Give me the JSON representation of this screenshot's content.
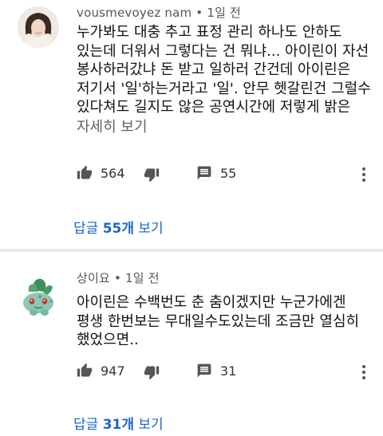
{
  "comments": [
    {
      "author": "vousmevoyez nam",
      "separator": "•",
      "time": "1일 전",
      "text_lines": [
        "누가봐도 대충 추고 표정 관리 하나도 안하도",
        "있는데 더워서 그렇다는 건 뭐냐... 아이린이 자선",
        "봉사하러갔냐 돈 받고 일하러 간건데 아이린은",
        "저기서 '일'하는거라고 '일'. 안무 헷갈린건 그럴수",
        "있다쳐도 길지도 않은 공연시간에 저렇게 밝은"
      ],
      "read_more": "자세히 보기",
      "likes": "564",
      "replies_count": "55",
      "replies_prefix": "답글 ",
      "replies_bold": "55개",
      "replies_suffix": " 보기"
    },
    {
      "author": "상이요",
      "separator": "•",
      "time": "1일 전",
      "text_lines": [
        "아이린은 수백번도 춘 춤이겠지만 누군가에겐",
        "평생 한번보는 무대일수도있는데 조금만 열심히",
        "했었으면.."
      ],
      "likes": "947",
      "replies_count": "31",
      "replies_prefix": "답글 ",
      "replies_bold": "31개",
      "replies_suffix": " 보기"
    }
  ],
  "colors": {
    "link_blue": "#1a66c8",
    "meta_gray": "#555555",
    "divider": "#e8e8e8"
  },
  "icons": [
    "avatar-photo",
    "avatar-plant-character",
    "thumbs-up-icon",
    "thumbs-down-icon",
    "reply-comment-icon",
    "more-vert-icon"
  ]
}
